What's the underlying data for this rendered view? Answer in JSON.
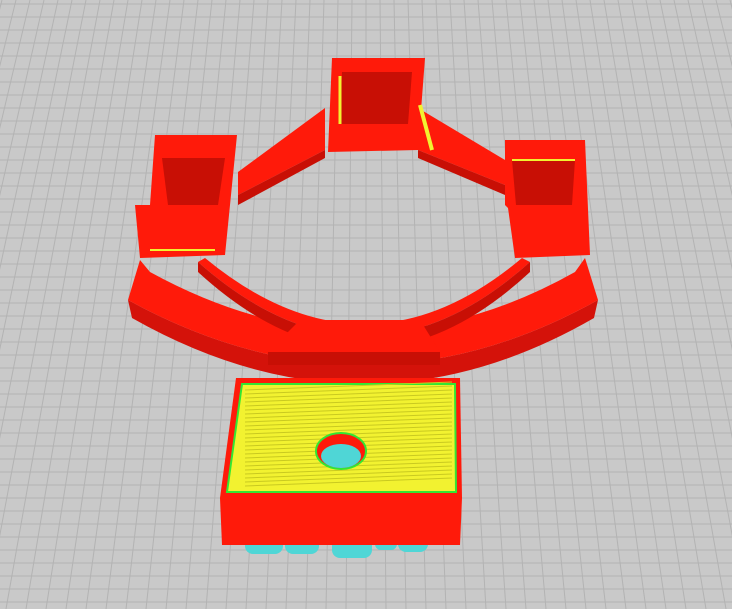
{
  "viewport": {
    "view": "3d-slice-preview",
    "colors": {
      "background": "#c9c9c9",
      "grid": "#b0b0b0",
      "wall": "#ff1a0a",
      "wall_shade": "#c80f05",
      "top_skin": "#f2f230",
      "inner_wall": "#33e633",
      "support": "#4fd6d6"
    }
  }
}
